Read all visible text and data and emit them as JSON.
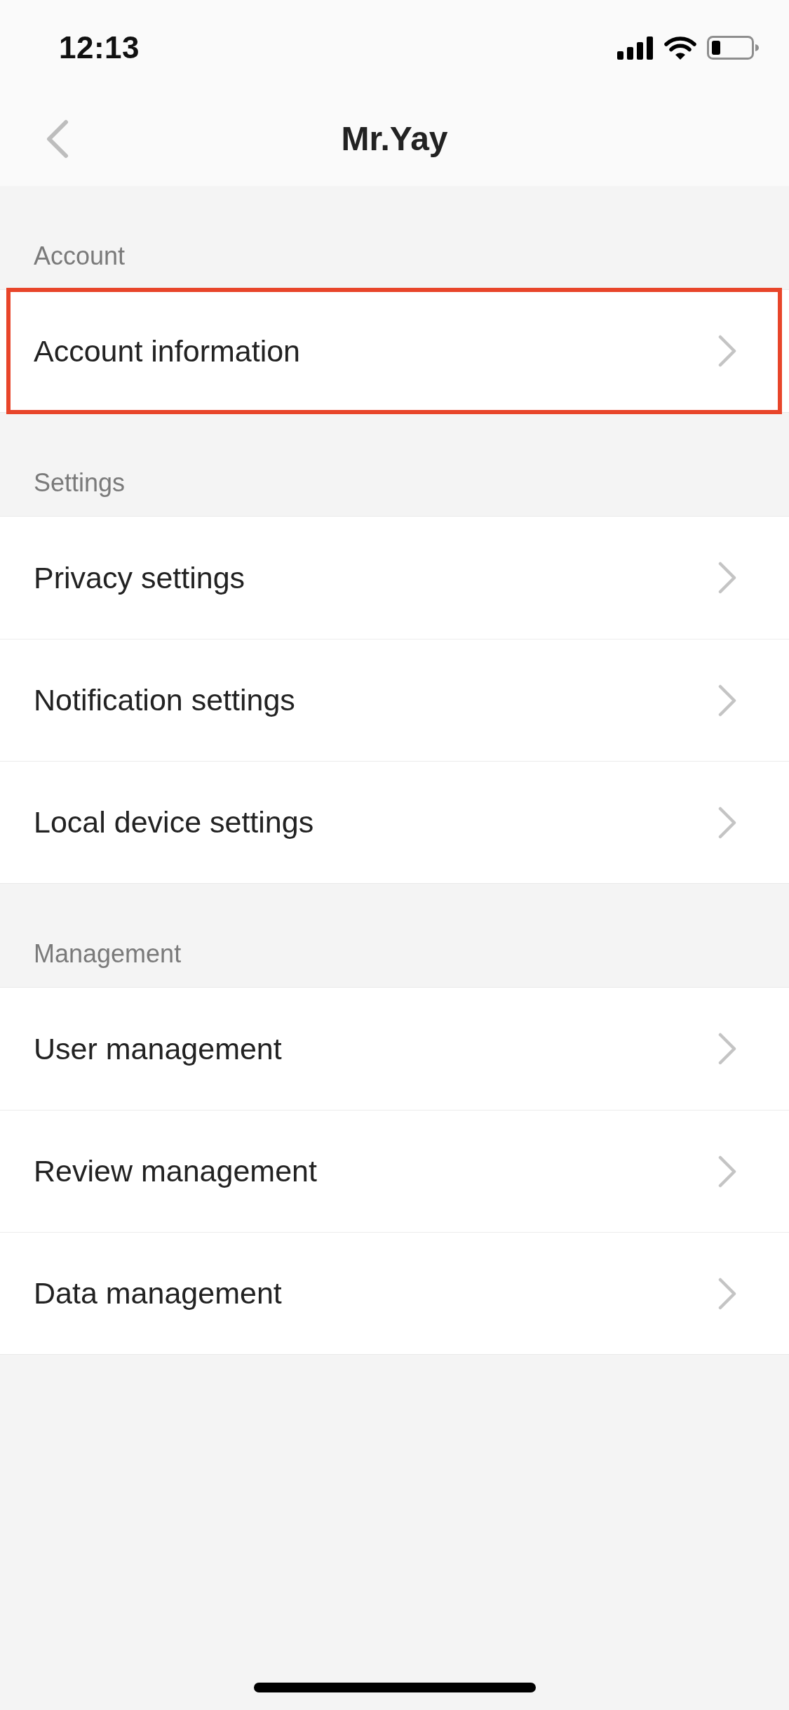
{
  "status_bar": {
    "time": "12:13"
  },
  "nav_bar": {
    "title": "Mr.Yay"
  },
  "sections": [
    {
      "title": "Account",
      "items": [
        {
          "label": "Account information",
          "highlighted": true
        }
      ]
    },
    {
      "title": "Settings",
      "items": [
        {
          "label": "Privacy settings",
          "highlighted": false
        },
        {
          "label": "Notification settings",
          "highlighted": false
        },
        {
          "label": "Local device settings",
          "highlighted": false
        }
      ]
    },
    {
      "title": "Management",
      "items": [
        {
          "label": "User management",
          "highlighted": false
        },
        {
          "label": "Review management",
          "highlighted": false
        },
        {
          "label": "Data management",
          "highlighted": false
        }
      ]
    }
  ]
}
